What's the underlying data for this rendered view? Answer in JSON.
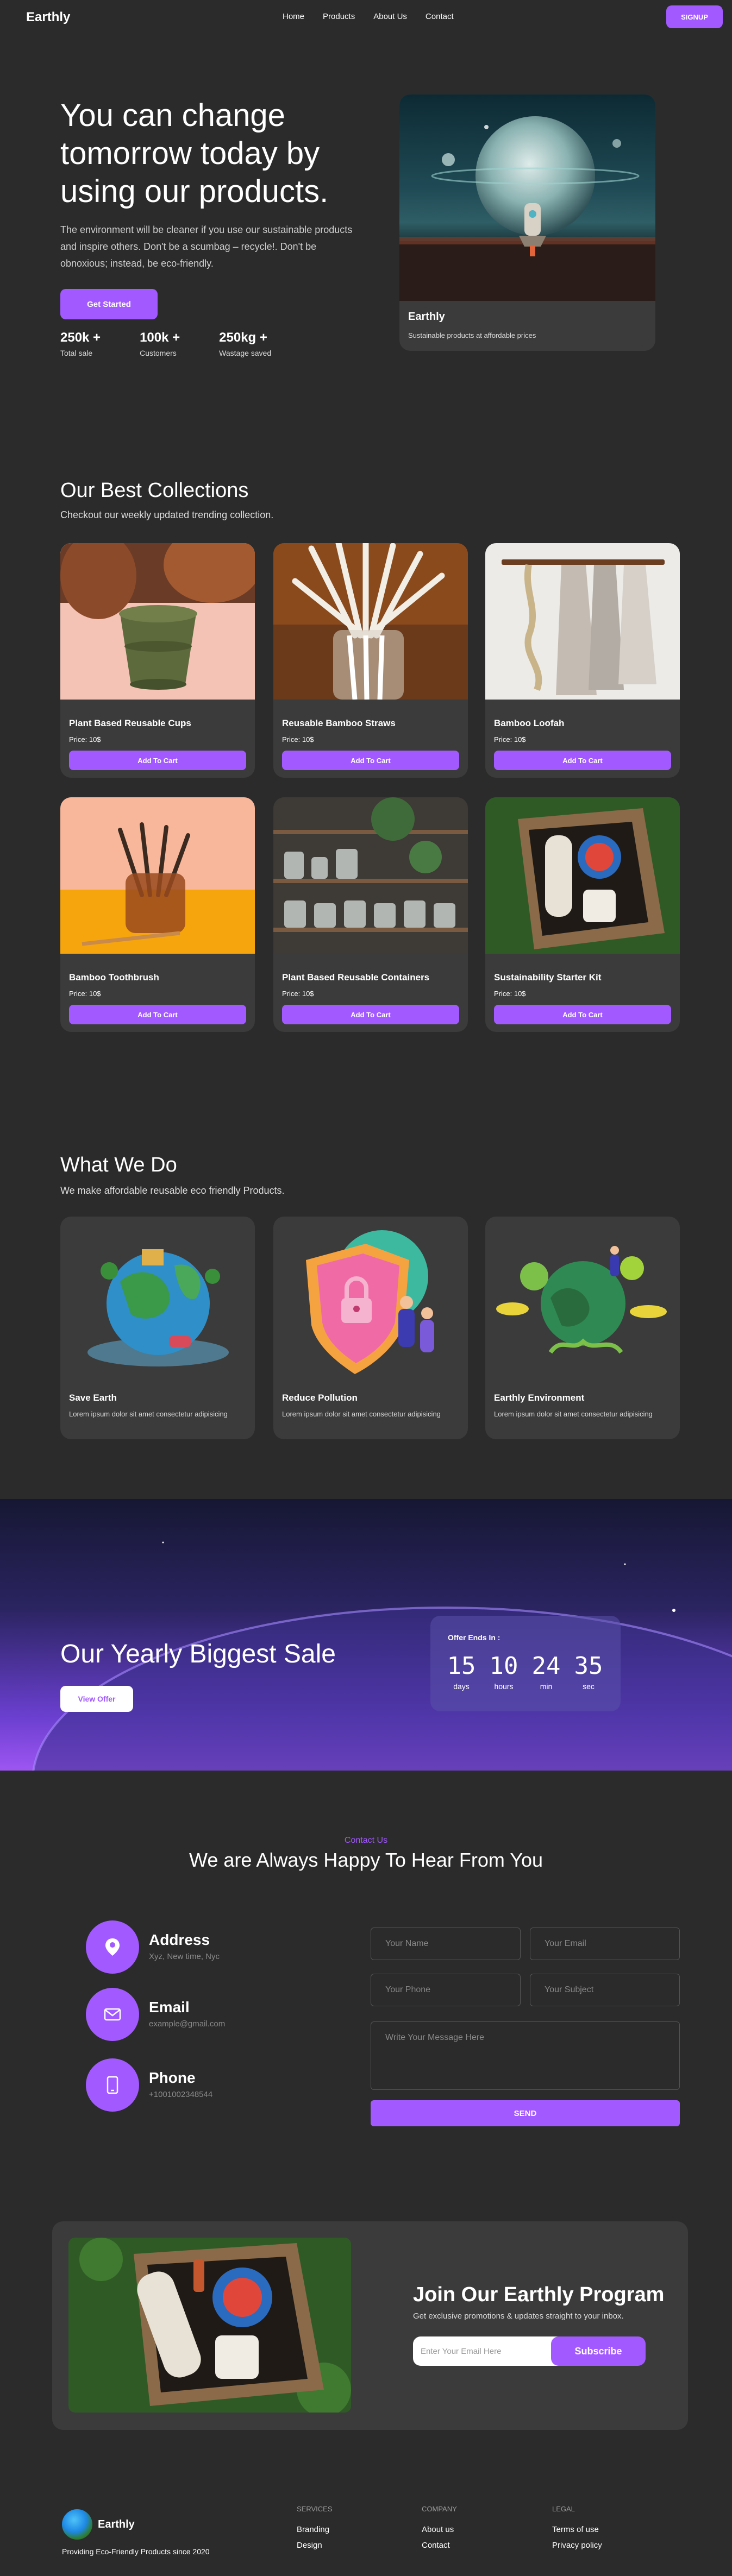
{
  "nav": {
    "brand": "Earthly",
    "links": [
      "Home",
      "Products",
      "About Us",
      "Contact"
    ],
    "signup_label": "SIGNUP"
  },
  "hero": {
    "title": "You can change tomorrow today by using our products.",
    "description": "The environment will be cleaner if you use our sustainable products and inspire others. Don't be a scumbag – recycle!. Don't be obnoxious; instead, be eco-friendly.",
    "cta_label": "Get Started",
    "stats": [
      {
        "value": "250k +",
        "label": "Total sale"
      },
      {
        "value": "100k +",
        "label": "Customers"
      },
      {
        "value": "250kg +",
        "label": "Wastage saved"
      }
    ],
    "card": {
      "title": "Earthly",
      "subtitle": "Sustainable products at affordable prices"
    }
  },
  "collections": {
    "title": "Our Best Collections",
    "subtitle": "Checkout our weekly updated trending collection.",
    "button_label": "Add To Cart",
    "items": [
      {
        "name": "Plant Based Reusable Cups",
        "price": "Price: 10$"
      },
      {
        "name": "Reusable Bamboo Straws",
        "price": "Price: 10$"
      },
      {
        "name": "Bamboo Loofah",
        "price": "Price: 10$"
      },
      {
        "name": "Bamboo Toothbrush",
        "price": "Price: 10$"
      },
      {
        "name": "Plant Based Reusable Containers",
        "price": "Price: 10$"
      },
      {
        "name": "Sustainability Starter Kit",
        "price": "Price: 10$"
      }
    ]
  },
  "what_we_do": {
    "title": "What We Do",
    "subtitle": "We make affordable reusable eco friendly Products.",
    "items": [
      {
        "name": "Save Earth",
        "desc": "Lorem ipsum dolor sit amet consectetur adipisicing"
      },
      {
        "name": "Reduce Pollution",
        "desc": "Lorem ipsum dolor sit amet consectetur adipisicing"
      },
      {
        "name": "Earthly Environment",
        "desc": "Lorem ipsum dolor sit amet consectetur adipisicing"
      }
    ]
  },
  "sale": {
    "title": "Our Yearly Biggest Sale",
    "button_label": "View Offer",
    "countdown_label": "Offer Ends In :",
    "units": [
      {
        "value": "15",
        "label": "days"
      },
      {
        "value": "10",
        "label": "hours"
      },
      {
        "value": "24",
        "label": "min"
      },
      {
        "value": "35",
        "label": "sec"
      }
    ]
  },
  "contact": {
    "kicker": "Contact Us",
    "title": "We are Always Happy To Hear From You",
    "info": [
      {
        "label": "Address",
        "value": "Xyz, New time, Nyc",
        "icon": "location-pin-icon"
      },
      {
        "label": "Email",
        "value": "example@gmail.com",
        "icon": "envelope-icon"
      },
      {
        "label": "Phone",
        "value": "+1001002348544",
        "icon": "phone-icon"
      }
    ],
    "placeholders": {
      "name": "Your Name",
      "email": "Your Email",
      "phone": "Your Phone",
      "subject": "Your Subject",
      "message": "Write Your Message Here"
    },
    "send_label": "SEND"
  },
  "newsletter": {
    "title": "Join Our Earthly Program",
    "subtitle": "Get exclusive promotions & updates straight to your inbox.",
    "placeholder": "Enter Your Email Here",
    "button_label": "Subscribe"
  },
  "footer": {
    "brand": "Earthly",
    "tagline": "Providing Eco-Friendly Products since 2020",
    "columns": [
      {
        "heading": "SERVICES",
        "links": [
          "Branding",
          "Design"
        ]
      },
      {
        "heading": "COMPANY",
        "links": [
          "About us",
          "Contact"
        ]
      },
      {
        "heading": "LEGAL",
        "links": [
          "Terms of use",
          "Privacy policy"
        ]
      }
    ]
  },
  "colors": {
    "accent": "#a259ff",
    "background": "#2b2b2b",
    "card": "#3b3b3b"
  }
}
